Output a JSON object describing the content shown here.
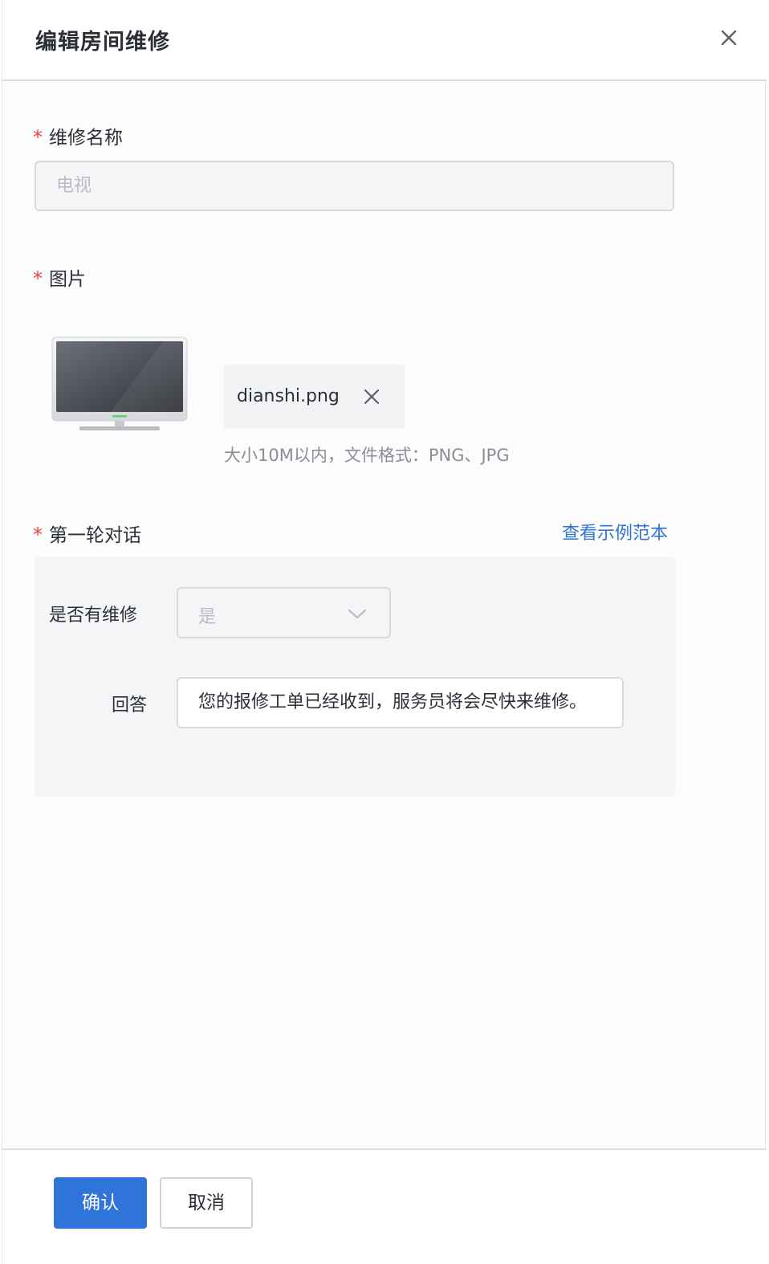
{
  "header": {
    "title": "编辑房间维修"
  },
  "form": {
    "required_mark": "*",
    "name": {
      "label": "维修名称",
      "placeholder": "电视"
    },
    "image": {
      "label": "图片",
      "file_name": "dianshi.png",
      "hint": "大小10M以内，文件格式：PNG、JPG"
    },
    "dialog": {
      "label": "第一轮对话",
      "example_link": "查看示例范本",
      "has_repair_label": "是否有维修",
      "has_repair_value": "是",
      "answer_label": "回答",
      "answer_value": "您的报修工单已经收到，服务员将会尽快来维修。"
    }
  },
  "footer": {
    "confirm_label": "确认",
    "cancel_label": "取消"
  },
  "colors": {
    "primary": "#2f74d8",
    "required": "#e8463c"
  },
  "icons": {
    "close": "close-icon",
    "file_remove": "close-icon",
    "select_arrow": "chevron-down-icon",
    "thumbnail": "tv-image"
  }
}
